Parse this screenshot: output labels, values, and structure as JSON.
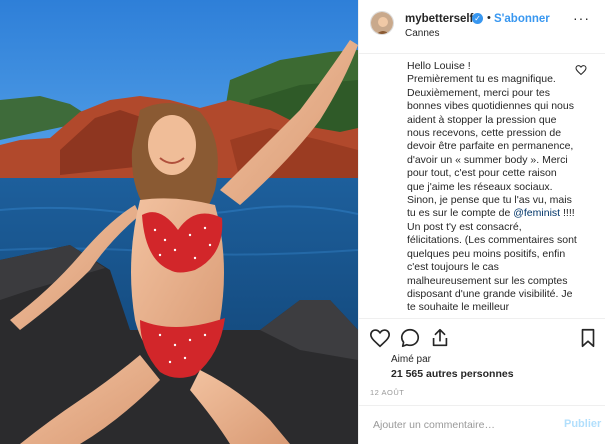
{
  "post": {
    "image_description_name": "post-photo"
  },
  "header": {
    "username": "mybetterself",
    "verified_symbol": "✓",
    "separator": "•",
    "follow_label": "S'abonner",
    "location": "Cannes",
    "more_symbol": "···"
  },
  "caption": {
    "text_before_mention": "Hello Louise !\nPremièrement tu es magnifique. Deuxièmement, merci pour tes bonnes vibes quotidiennes qui nous aident à stopper la pression que nous recevons, cette pression de devoir être parfaite en permanence, d'avoir un « summer body ». Merci pour tout, c'est pour cette raison que j'aime les réseaux sociaux. Sinon, je pense que tu l'as vu, mais tu es sur le compte de ",
    "mention": "@feminist",
    "text_after_mention": " !!!! Un post t'y est consacré, félicitations. (Les commentaires sont quelques peu moins positifs, enfin c'est toujours le cas malheureusement sur les comptes disposant d'une grande visibilité. Je te souhaite le meilleur"
  },
  "actions": {
    "like_icon": "heart-icon",
    "comment_icon": "comment-icon",
    "share_icon": "share-icon",
    "save_icon": "bookmark-icon"
  },
  "likes": {
    "liked_by_label": "Aimé par",
    "count_text": "21 565 autres personnes"
  },
  "date": "12 AOÛT",
  "add_comment": {
    "placeholder": "Ajouter un commentaire…",
    "publish_label": "Publier"
  },
  "colors": {
    "accent": "#3897f0",
    "publish_disabled": "#b2dffc",
    "border": "#efefef",
    "text": "#262626",
    "muted": "#999999"
  }
}
